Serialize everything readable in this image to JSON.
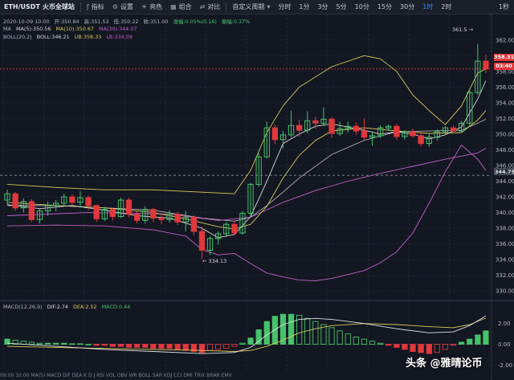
{
  "toolbar": {
    "symbol": "ETH/USDT",
    "exchange": "火币全球站",
    "indicators_label": "指标",
    "settings_label": "设置",
    "theme_label": "亮色",
    "combo_label": "组合",
    "compare_label": "对比",
    "custom_period_label": "自定义周期",
    "timeframes": [
      "分时",
      "1分",
      "3分",
      "5分",
      "10分",
      "15分",
      "30分",
      "1时",
      "2时"
    ],
    "active_timeframe": "1时",
    "right_label": "1秒",
    "accent_color": "#2f8cff"
  },
  "legend": {
    "ohlc": {
      "date": "2020-10-09 10:00",
      "open": "开:350.84",
      "high": "高:351.53",
      "low": "低:350.22",
      "close": "收:351.00",
      "change": "涨幅:0.05%(0.16)",
      "amplitude": "振幅:0.37%"
    },
    "ma": {
      "name": "MA",
      "ma5": "MA(5):350.56",
      "ma10": "MA(10):350.67",
      "ma30": "MA(30):344.07"
    },
    "boll": {
      "name": "BOLL(20,2)",
      "boll": "BOLL:346.21",
      "ub": "UB:358.33",
      "lb": "LB:334.09"
    },
    "macd": {
      "name": "MACD(12,26,9)",
      "dif": "DIF:2.74",
      "dea": "DEA:2.52",
      "macd": "MACD:0.44"
    }
  },
  "price_tags": {
    "last_price": "358.31",
    "countdown": "03:40",
    "crosshair_price": "344.75"
  },
  "annotations": {
    "high": "361.5",
    "low": "334.13"
  },
  "price_axis": [
    "362.00",
    "360.00",
    "358.00",
    "356.00",
    "354.00",
    "352.00",
    "350.00",
    "348.00",
    "346.00",
    "344.00",
    "342.00",
    "340.00",
    "338.00",
    "336.00",
    "334.00",
    "332.00",
    "330.00"
  ],
  "macd_axis": [
    "2.00",
    "0.00",
    "-2.00"
  ],
  "bottom_axis_text": "09:00   10:00 MA(5)   MACD   DIF   DEA   K   D   J   RSI   VOL   OBV   WR   BOLL   SAR   KDJ   CCI   DMI   TRIX   BRAR   EMV",
  "watermark": "头条 @雅晴论币",
  "colors": {
    "up": "#46c26a",
    "down": "#e0383c",
    "background": "#131722",
    "ma5": "#d8d8d8",
    "ma10": "#d9c95a",
    "ma30": "#c160c7"
  },
  "chart_data": {
    "type": "candlestick",
    "price_range": [
      329,
      363
    ],
    "macd_range": [
      -2.6,
      3.3
    ],
    "candles": [
      [
        341.6,
        342.9,
        341.0,
        342.4
      ],
      [
        342.4,
        342.6,
        340.2,
        340.6
      ],
      [
        340.6,
        341.8,
        340.0,
        341.4
      ],
      [
        341.4,
        341.7,
        338.8,
        339.1
      ],
      [
        339.1,
        340.6,
        338.6,
        340.2
      ],
      [
        340.2,
        341.4,
        339.6,
        340.9
      ],
      [
        340.9,
        341.6,
        340.2,
        341.2
      ],
      [
        341.2,
        342.4,
        340.8,
        342.0
      ],
      [
        342.0,
        342.3,
        340.9,
        341.3
      ],
      [
        341.3,
        342.7,
        340.6,
        341.9
      ],
      [
        341.9,
        342.2,
        340.3,
        340.9
      ],
      [
        340.9,
        341.0,
        338.8,
        339.2
      ],
      [
        339.2,
        340.7,
        338.9,
        340.4
      ],
      [
        340.4,
        340.6,
        339.0,
        339.5
      ],
      [
        339.5,
        341.9,
        339.3,
        341.6
      ],
      [
        341.6,
        341.9,
        339.4,
        339.8
      ],
      [
        339.8,
        340.2,
        338.6,
        339.0
      ],
      [
        339.0,
        340.8,
        338.6,
        340.4
      ],
      [
        340.4,
        340.6,
        338.8,
        339.3
      ],
      [
        339.3,
        339.9,
        338.5,
        339.1
      ],
      [
        339.1,
        340.3,
        338.7,
        339.8
      ],
      [
        339.8,
        340.1,
        338.4,
        338.8
      ],
      [
        338.8,
        340.2,
        337.6,
        339.4
      ],
      [
        339.4,
        339.6,
        337.1,
        337.6
      ],
      [
        337.6,
        338.2,
        334.1,
        335.2
      ],
      [
        335.2,
        337.0,
        334.6,
        336.7
      ],
      [
        336.7,
        337.6,
        335.9,
        337.3
      ],
      [
        337.3,
        338.8,
        336.9,
        338.5
      ],
      [
        338.5,
        339.0,
        337.1,
        337.4
      ],
      [
        337.4,
        340.2,
        337.2,
        339.9
      ],
      [
        339.9,
        343.8,
        339.6,
        343.6
      ],
      [
        343.6,
        347.6,
        343.3,
        347.1
      ],
      [
        347.1,
        351.6,
        346.9,
        350.8
      ],
      [
        350.8,
        351.2,
        348.7,
        349.3
      ],
      [
        349.3,
        350.4,
        348.2,
        349.9
      ],
      [
        349.9,
        353.0,
        349.6,
        351.1
      ],
      [
        351.1,
        351.8,
        349.7,
        350.5
      ],
      [
        350.5,
        352.9,
        350.1,
        351.7
      ],
      [
        351.7,
        352.2,
        350.7,
        351.4
      ],
      [
        351.4,
        353.4,
        351.0,
        351.9
      ],
      [
        351.9,
        352.2,
        349.5,
        350.1
      ],
      [
        350.1,
        351.6,
        349.8,
        350.7
      ],
      [
        350.7,
        351.6,
        350.2,
        351.0
      ],
      [
        351.0,
        351.5,
        349.9,
        350.4
      ],
      [
        350.4,
        352.0,
        349.3,
        349.6
      ],
      [
        349.6,
        350.4,
        348.5,
        349.8
      ],
      [
        349.8,
        351.1,
        349.5,
        350.8
      ],
      [
        350.8,
        351.2,
        350.4,
        351.0
      ],
      [
        351.0,
        351.3,
        349.3,
        349.7
      ],
      [
        349.7,
        350.5,
        349.3,
        350.3
      ],
      [
        350.3,
        350.7,
        349.5,
        349.8
      ],
      [
        349.8,
        350.3,
        348.4,
        348.8
      ],
      [
        348.8,
        350.1,
        348.4,
        349.6
      ],
      [
        349.6,
        350.6,
        349.2,
        350.3
      ],
      [
        350.3,
        351.0,
        349.9,
        350.8
      ],
      [
        350.8,
        351.1,
        350.5,
        350.4
      ],
      [
        350.4,
        351.7,
        350.2,
        351.4
      ],
      [
        351.4,
        355.8,
        351.0,
        355.3
      ],
      [
        355.3,
        361.5,
        355.0,
        359.3
      ],
      [
        359.3,
        360.1,
        357.8,
        358.3
      ]
    ],
    "ma5": [
      [
        0,
        341.0
      ],
      [
        4,
        340.5
      ],
      [
        8,
        340.9
      ],
      [
        12,
        340.3
      ],
      [
        16,
        339.6
      ],
      [
        20,
        339.3
      ],
      [
        24,
        338.0
      ],
      [
        26,
        336.8
      ],
      [
        28,
        337.2
      ],
      [
        30,
        339.5
      ],
      [
        32,
        344.0
      ],
      [
        34,
        348.8
      ],
      [
        36,
        350.0
      ],
      [
        38,
        351.0
      ],
      [
        40,
        351.3
      ],
      [
        42,
        350.9
      ],
      [
        44,
        350.5
      ],
      [
        46,
        350.0
      ],
      [
        48,
        350.3
      ],
      [
        50,
        350.0
      ],
      [
        52,
        349.4
      ],
      [
        54,
        349.9
      ],
      [
        56,
        350.9
      ],
      [
        58,
        354.5
      ],
      [
        59,
        356.8
      ]
    ],
    "ma10": [
      [
        0,
        341.3
      ],
      [
        6,
        340.9
      ],
      [
        12,
        340.6
      ],
      [
        18,
        340.0
      ],
      [
        22,
        339.2
      ],
      [
        26,
        338.2
      ],
      [
        28,
        337.9
      ],
      [
        30,
        338.5
      ],
      [
        32,
        340.8
      ],
      [
        34,
        344.4
      ],
      [
        36,
        347.3
      ],
      [
        38,
        349.2
      ],
      [
        40,
        350.4
      ],
      [
        44,
        350.8
      ],
      [
        48,
        350.4
      ],
      [
        52,
        350.1
      ],
      [
        56,
        350.2
      ],
      [
        58,
        351.8
      ],
      [
        59,
        353.0
      ]
    ],
    "ma30": [
      [
        0,
        339.6
      ],
      [
        10,
        340.0
      ],
      [
        20,
        339.8
      ],
      [
        26,
        339.0
      ],
      [
        30,
        339.4
      ],
      [
        34,
        341.3
      ],
      [
        38,
        342.8
      ],
      [
        42,
        344.0
      ],
      [
        46,
        345.0
      ],
      [
        50,
        345.9
      ],
      [
        54,
        346.8
      ],
      [
        58,
        347.6
      ],
      [
        59,
        348.2
      ]
    ],
    "boll_upper": [
      [
        0,
        343.6
      ],
      [
        6,
        343.2
      ],
      [
        12,
        342.9
      ],
      [
        18,
        342.9
      ],
      [
        24,
        342.6
      ],
      [
        28,
        342.4
      ],
      [
        30,
        345.4
      ],
      [
        32,
        350.2
      ],
      [
        34,
        353.6
      ],
      [
        36,
        356.0
      ],
      [
        40,
        358.6
      ],
      [
        44,
        360.0
      ],
      [
        46,
        359.6
      ],
      [
        48,
        358.0
      ],
      [
        50,
        355.0
      ],
      [
        52,
        353.0
      ],
      [
        54,
        351.2
      ],
      [
        56,
        353.6
      ],
      [
        58,
        357.8
      ],
      [
        59,
        358.3
      ]
    ],
    "boll_mid": [
      [
        0,
        340.9
      ],
      [
        6,
        340.9
      ],
      [
        12,
        340.6
      ],
      [
        18,
        340.3
      ],
      [
        24,
        339.3
      ],
      [
        28,
        338.9
      ],
      [
        30,
        339.4
      ],
      [
        32,
        340.9
      ],
      [
        34,
        342.6
      ],
      [
        36,
        344.4
      ],
      [
        40,
        347.4
      ],
      [
        44,
        349.2
      ],
      [
        48,
        350.3
      ],
      [
        52,
        350.4
      ],
      [
        56,
        350.5
      ],
      [
        58,
        351.4
      ],
      [
        59,
        351.9
      ]
    ],
    "boll_lower": [
      [
        0,
        338.3
      ],
      [
        6,
        338.4
      ],
      [
        12,
        338.3
      ],
      [
        18,
        337.8
      ],
      [
        22,
        337.0
      ],
      [
        24,
        335.3
      ],
      [
        26,
        334.6
      ],
      [
        28,
        334.8
      ],
      [
        30,
        333.5
      ],
      [
        32,
        332.3
      ],
      [
        34,
        331.8
      ],
      [
        36,
        331.4
      ],
      [
        38,
        331.3
      ],
      [
        40,
        331.6
      ],
      [
        42,
        332.1
      ],
      [
        44,
        332.6
      ],
      [
        46,
        333.6
      ],
      [
        48,
        335.0
      ],
      [
        50,
        337.4
      ],
      [
        52,
        341.2
      ],
      [
        54,
        345.2
      ],
      [
        56,
        348.6
      ],
      [
        58,
        346.8
      ],
      [
        59,
        345.4
      ]
    ],
    "macd_hist": [
      0.5,
      0.4,
      0.3,
      0.2,
      0.1,
      0.1,
      0.1,
      0.1,
      0.05,
      0.05,
      0.0,
      -0.1,
      -0.1,
      -0.2,
      -0.2,
      -0.3,
      -0.3,
      -0.3,
      -0.4,
      -0.4,
      -0.4,
      -0.5,
      -0.6,
      -0.7,
      -0.8,
      -0.6,
      -0.5,
      -0.4,
      -0.2,
      0.1,
      0.6,
      1.4,
      2.2,
      2.7,
      2.9,
      2.9,
      2.8,
      2.5,
      2.2,
      1.9,
      1.6,
      1.3,
      1.0,
      0.7,
      0.5,
      0.3,
      0.1,
      -0.1,
      -0.3,
      -0.5,
      -0.7,
      -0.8,
      -0.9,
      -0.8,
      -0.5,
      -0.1,
      0.2,
      0.5,
      0.9,
      1.3
    ],
    "dif": [
      [
        0,
        0.1
      ],
      [
        6,
        -0.2
      ],
      [
        12,
        -0.5
      ],
      [
        18,
        -0.7
      ],
      [
        24,
        -0.9
      ],
      [
        28,
        -0.8
      ],
      [
        30,
        -0.3
      ],
      [
        32,
        0.9
      ],
      [
        34,
        1.9
      ],
      [
        36,
        2.4
      ],
      [
        38,
        2.5
      ],
      [
        40,
        2.4
      ],
      [
        44,
        2.0
      ],
      [
        48,
        1.5
      ],
      [
        52,
        1.1
      ],
      [
        55,
        1.2
      ],
      [
        57,
        1.8
      ],
      [
        59,
        2.74
      ]
    ],
    "dea": [
      [
        0,
        -0.2
      ],
      [
        6,
        -0.3
      ],
      [
        12,
        -0.4
      ],
      [
        18,
        -0.5
      ],
      [
        24,
        -0.6
      ],
      [
        28,
        -0.7
      ],
      [
        30,
        -0.6
      ],
      [
        32,
        -0.2
      ],
      [
        34,
        0.4
      ],
      [
        36,
        1.1
      ],
      [
        38,
        1.5
      ],
      [
        40,
        1.8
      ],
      [
        44,
        2.0
      ],
      [
        48,
        1.9
      ],
      [
        52,
        1.7
      ],
      [
        55,
        1.6
      ],
      [
        57,
        1.9
      ],
      [
        59,
        2.52
      ]
    ]
  }
}
